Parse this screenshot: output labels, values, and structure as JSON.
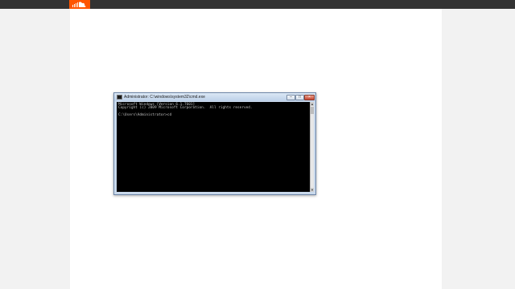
{
  "site": {
    "brand_color": "#ff5500",
    "logo_icon": "cloud-icon"
  },
  "cmd_window": {
    "title": "Administrator: C:\\windows\\system32\\cmd.exe",
    "minimize_glyph": "–",
    "maximize_glyph": "□",
    "close_glyph": "×",
    "console_lines": [
      "Microsoft Windows [Version 6.1.7601]",
      "Copyright (c) 2009 Microsoft Corporation.  All rights reserved.",
      "C:\\Users\\Administrator>cd"
    ],
    "console_bg": "#000000",
    "console_fg": "#c0c0c0"
  }
}
